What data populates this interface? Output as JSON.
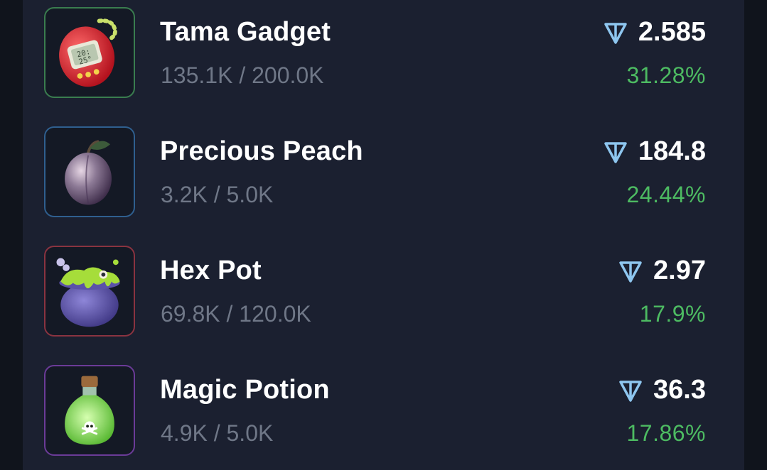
{
  "items": [
    {
      "name": "Tama Gadget",
      "supply": "135.1K / 200.0K",
      "price": "2.585",
      "change": "31.28%",
      "border_color": "#3a7d4f",
      "icon": "tama-gadget-icon"
    },
    {
      "name": "Precious Peach",
      "supply": "3.2K / 5.0K",
      "price": "184.8",
      "change": "24.44%",
      "border_color": "#2f5f8f",
      "icon": "precious-peach-icon"
    },
    {
      "name": "Hex Pot",
      "supply": "69.8K / 120.0K",
      "price": "2.97",
      "change": "17.9%",
      "border_color": "#8a3340",
      "icon": "hex-pot-icon"
    },
    {
      "name": "Magic Potion",
      "supply": "4.9K / 5.0K",
      "price": "36.3",
      "change": "17.86%",
      "border_color": "#6b3b98",
      "icon": "magic-potion-icon"
    }
  ],
  "currency_icon": "ton-icon",
  "colors": {
    "background": "#10141c",
    "panel": "#1b2030",
    "name_text": "#ffffff",
    "supply_text": "#6f7787",
    "positive": "#4dbb62",
    "ton_blue": "#8ec6ef"
  }
}
